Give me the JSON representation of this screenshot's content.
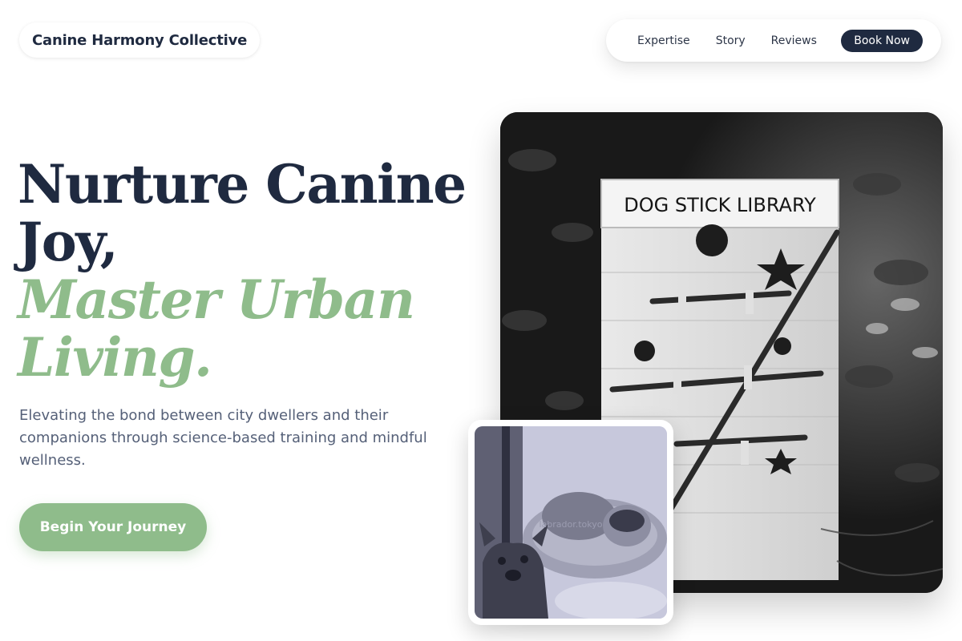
{
  "header": {
    "brand": "Canine Harmony Collective",
    "nav": [
      {
        "label": "Expertise"
      },
      {
        "label": "Story"
      },
      {
        "label": "Reviews"
      }
    ],
    "book_label": "Book Now"
  },
  "hero": {
    "headline_line1": "Nurture Canine Joy,",
    "headline_line2": "Master Urban Living.",
    "subtitle": "Elevating the bond between city dwellers and their companions through science-based training and mindful wellness.",
    "cta_label": "Begin Your Journey"
  },
  "images": {
    "main_sign_text": "DOG STICK LIBRARY",
    "card_watermark": "labrador.tokyo"
  },
  "colors": {
    "navy": "#1f2a40",
    "sage": "#8fbc8b",
    "muted_text": "#556078"
  }
}
